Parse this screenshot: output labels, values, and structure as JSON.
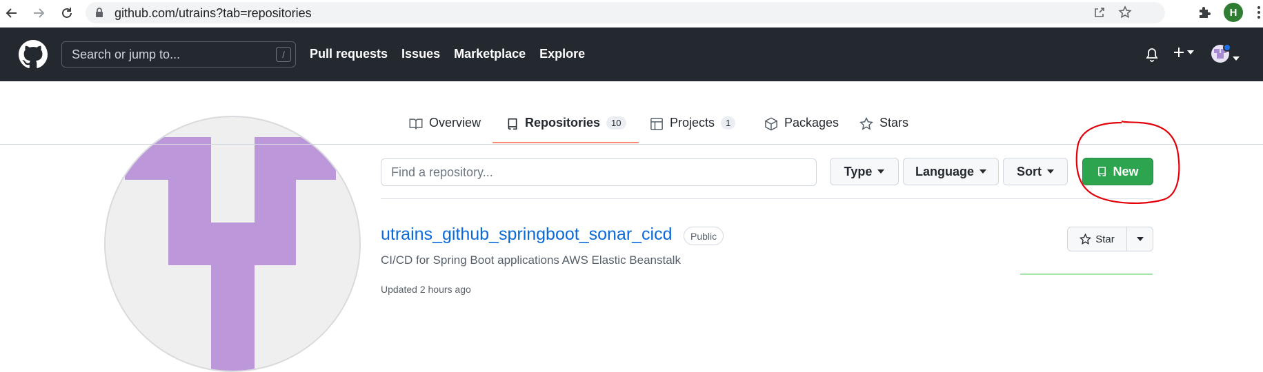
{
  "browser": {
    "url": "github.com/utrains?tab=repositories",
    "profile_initial": "H"
  },
  "header": {
    "search_placeholder": "Search or jump to...",
    "search_shortcut": "/",
    "nav": [
      "Pull requests",
      "Issues",
      "Marketplace",
      "Explore"
    ]
  },
  "tabs": [
    {
      "label": "Overview",
      "icon": "book-icon"
    },
    {
      "label": "Repositories",
      "count": "10",
      "icon": "repo-icon",
      "selected": true
    },
    {
      "label": "Projects",
      "count": "1",
      "icon": "table-icon"
    },
    {
      "label": "Packages",
      "icon": "package-icon"
    },
    {
      "label": "Stars",
      "icon": "star-icon"
    }
  ],
  "filters": {
    "search_placeholder": "Find a repository...",
    "type_label": "Type",
    "language_label": "Language",
    "sort_label": "Sort",
    "new_label": "New"
  },
  "repo": {
    "name": "utrains_github_springboot_sonar_cicd",
    "visibility": "Public",
    "description": "CI/CD for Spring Boot applications AWS Elastic Beanstalk",
    "updated": "Updated 2 hours ago",
    "star_label": "Star"
  },
  "colors": {
    "header_bg": "#24292f",
    "link": "#0969da",
    "new_button": "#2da44e",
    "tab_underline": "#fd8c73",
    "avatar_purple": "#bc98da",
    "annotation_red": "#e3000b"
  }
}
